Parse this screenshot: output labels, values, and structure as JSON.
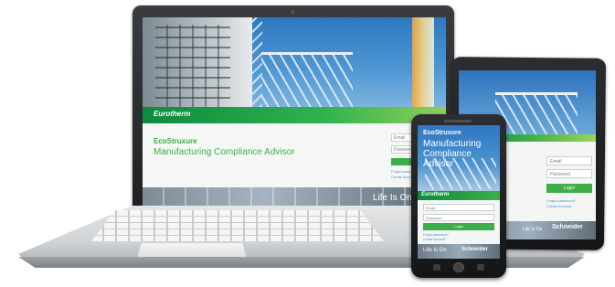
{
  "laptop": {
    "brand": "Eurotherm",
    "product_logo": "EcoStruxure",
    "title": "Manufacturing Compliance Advisor",
    "email_placeholder": "Email",
    "password_placeholder": "Password",
    "links": [
      "Forgot password?",
      "Create Account"
    ],
    "tagline": "Life Is On",
    "colors": {
      "accent": "#3dae49",
      "sky": "#2e78c0"
    }
  },
  "tablet": {
    "email_placeholder": "Email",
    "password_placeholder": "Password",
    "login_label": "Login",
    "links": [
      "Forgot password?",
      "Create Account"
    ],
    "tagline": "Life Is On",
    "company": "Schneider"
  },
  "phone": {
    "product_logo": "EcoStruxure",
    "title": "Manufacturing Compliance Advisor",
    "brand": "Eurotherm",
    "email_placeholder": "Email",
    "password_placeholder": "Password",
    "login_label": "Login",
    "links": [
      "Forgot password?",
      "Create Account"
    ],
    "tagline": "Life Is On",
    "company": "Schneider"
  }
}
